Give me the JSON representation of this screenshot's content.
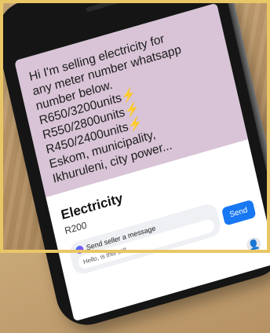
{
  "post": {
    "lines": [
      "Hi I'm selling electricity for",
      "any meter number whatsapp",
      "number below."
    ],
    "price_lines": [
      {
        "text": "R650/3200units",
        "icon": "lightning-bolt-icon"
      },
      {
        "text": "R550/2800units",
        "icon": "lightning-bolt-icon"
      },
      {
        "text": "R450/2400units",
        "icon": "lightning-bolt-icon"
      }
    ],
    "suppliers_line_1": "Eskom, municipality,",
    "suppliers_line_2": "Ikhuruleni, city power...",
    "background_color": "#d8c4d6"
  },
  "listing": {
    "title": "Electricity",
    "price": "R200",
    "message_prompt": "Send seller a message",
    "message_preview": "Hello, is this still",
    "send_label": "Send",
    "accent_color": "#1877f2"
  },
  "icons": {
    "bolt": "⚡",
    "person": "👤"
  }
}
